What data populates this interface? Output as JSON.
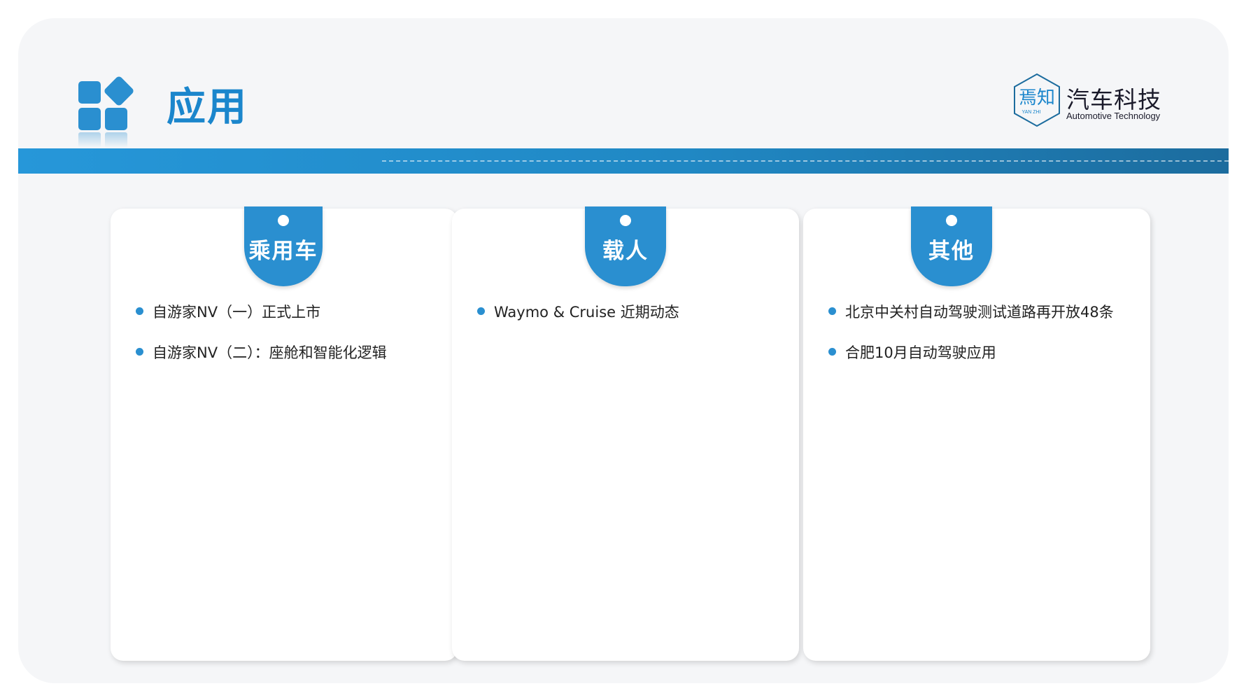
{
  "header": {
    "title": "应用"
  },
  "logo": {
    "brand_cn": "汽车科技",
    "brand_en": "Automotive Technology",
    "mark_text": "焉知",
    "mark_sub": "YAN ZHI"
  },
  "colors": {
    "accent": "#2a8fd0",
    "title": "#1b86cc",
    "band_start": "#2697d9",
    "band_end": "#1c6c9e",
    "background": "#f5f6f8"
  },
  "cards": [
    {
      "label": "乘用车",
      "items": [
        "自游家NV（一）正式上市",
        "自游家NV（二）：座舱和智能化逻辑"
      ]
    },
    {
      "label": "载人",
      "items": [
        "Waymo & Cruise 近期动态"
      ]
    },
    {
      "label": "其他",
      "items": [
        "北京中关村自动驾驶测试道路再开放48条",
        "合肥10月自动驾驶应用"
      ]
    }
  ]
}
